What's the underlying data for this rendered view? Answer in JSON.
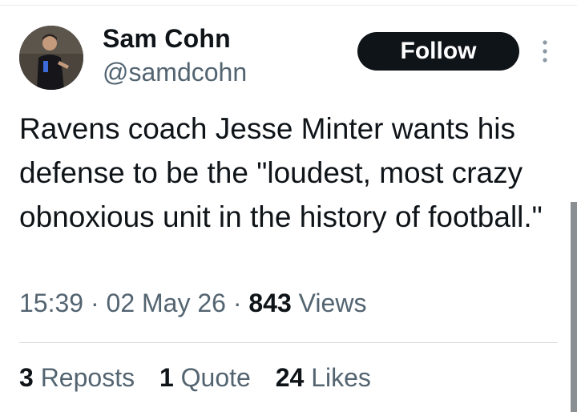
{
  "author": {
    "display_name": "Sam Cohn",
    "handle": "@samdcohn",
    "avatar_icon": "profile-photo"
  },
  "follow_label": "Follow",
  "more_icon": "more-vertical-icon",
  "tweet": {
    "text": "Ravens coach Jesse Minter wants his defense to be the \"loudest, most crazy obnoxious unit in the history of football.\""
  },
  "meta": {
    "time": "15:39",
    "separator": "·",
    "date": "02 May 26",
    "views_count": "843",
    "views_label": "Views"
  },
  "stats": {
    "reposts_count": "3",
    "reposts_label": "Reposts",
    "quotes_count": "1",
    "quotes_label": "Quote",
    "likes_count": "24",
    "likes_label": "Likes"
  },
  "colors": {
    "text_primary": "#0f1419",
    "text_secondary": "#536471",
    "follow_bg": "#0f1419",
    "divider": "#d6dade"
  }
}
